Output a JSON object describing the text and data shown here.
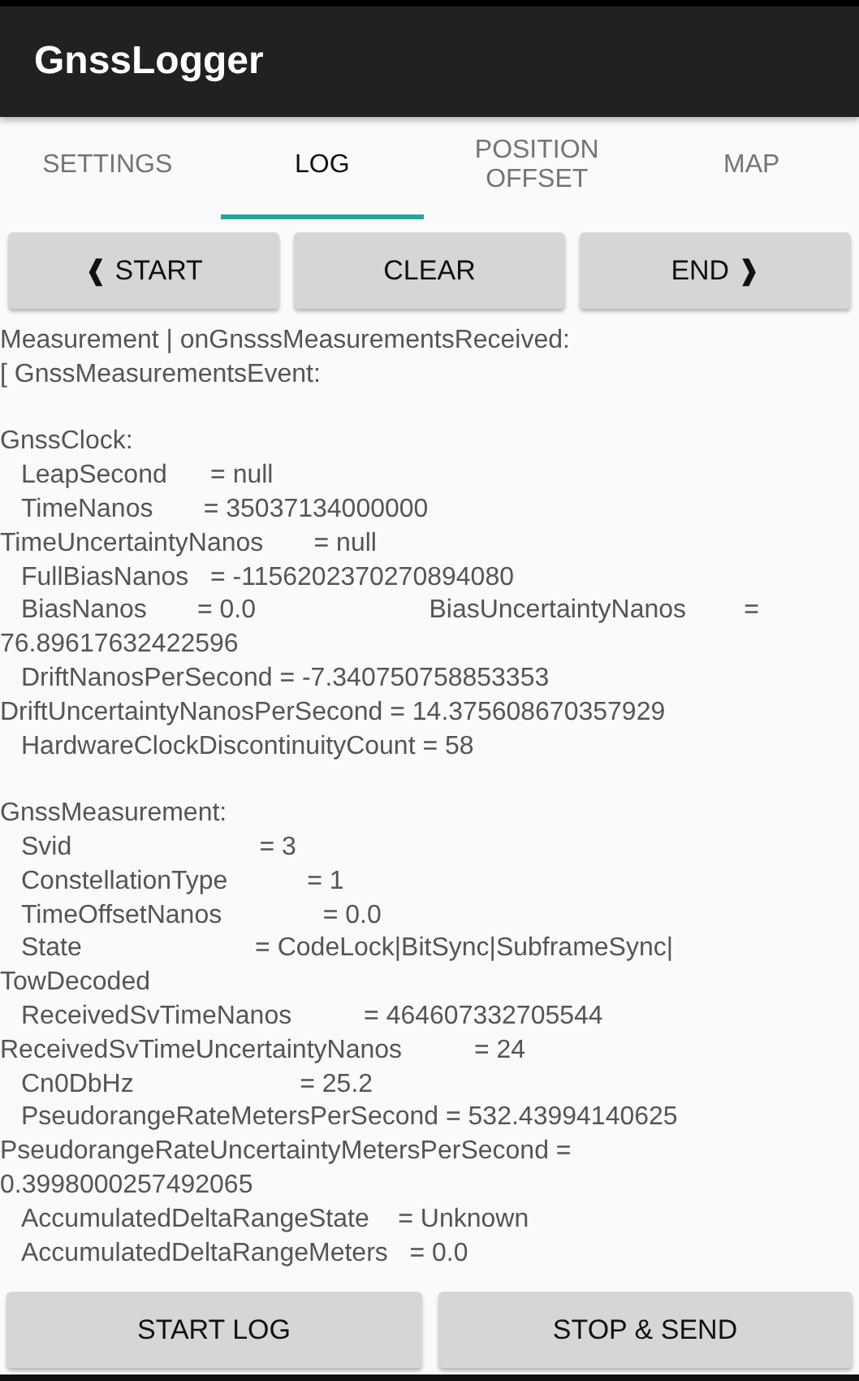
{
  "app_bar": {
    "title": "GnssLogger"
  },
  "tabs": [
    {
      "label": "SETTINGS",
      "selected": false
    },
    {
      "label": "LOG",
      "selected": true
    },
    {
      "label": "POSITION OFFSET",
      "selected": false
    },
    {
      "label": "MAP",
      "selected": false
    }
  ],
  "top_buttons": [
    "❰ START",
    "CLEAR",
    "END ❱"
  ],
  "log": [
    {
      "lines": [
        {
          "text": "Measurement | onGnsssMeasurementsReceived:",
          "indent": false
        },
        {
          "text": "[ GnssMeasurementsEvent:",
          "indent": false
        }
      ]
    },
    {
      "lines": [
        {
          "text": "GnssClock:",
          "indent": false
        },
        {
          "text": "LeapSecond      = null",
          "indent": true
        },
        {
          "text": "TimeNanos       = 35037134000000",
          "indent": true
        },
        {
          "text": "TimeUncertaintyNanos       = null",
          "indent": false
        },
        {
          "text": "FullBiasNanos   = -1156202370270894080",
          "indent": true
        },
        {
          "text": "BiasNanos       = 0.0                        BiasUncertaintyNanos        =",
          "indent": true
        },
        {
          "text": "76.89617632422596",
          "indent": false
        },
        {
          "text": "DriftNanosPerSecond = -7.340750758853353",
          "indent": true
        },
        {
          "text": "DriftUncertaintyNanosPerSecond = 14.375608670357929",
          "indent": false
        },
        {
          "text": "HardwareClockDiscontinuityCount = 58",
          "indent": true
        }
      ]
    },
    {
      "lines": [
        {
          "text": "GnssMeasurement:",
          "indent": false
        },
        {
          "text": "Svid                          = 3",
          "indent": true
        },
        {
          "text": "ConstellationType           = 1",
          "indent": true
        },
        {
          "text": "TimeOffsetNanos              = 0.0",
          "indent": true
        },
        {
          "text": "State                        = CodeLock|BitSync|SubframeSync|",
          "indent": true
        },
        {
          "text": "TowDecoded",
          "indent": false
        },
        {
          "text": "ReceivedSvTimeNanos          = 464607332705544",
          "indent": true
        },
        {
          "text": "ReceivedSvTimeUncertaintyNanos          = 24",
          "indent": false
        },
        {
          "text": "Cn0DbHz                       = 25.2",
          "indent": true
        },
        {
          "text": "PseudorangeRateMetersPerSecond = 532.43994140625",
          "indent": true
        },
        {
          "text": "PseudorangeRateUncertaintyMetersPerSecond =",
          "indent": false
        },
        {
          "text": "0.3998000257492065",
          "indent": false
        },
        {
          "text": "AccumulatedDeltaRangeState    = Unknown",
          "indent": true
        },
        {
          "text": "AccumulatedDeltaRangeMeters   = 0.0",
          "indent": true
        }
      ]
    }
  ],
  "bottom_buttons": [
    "START LOG",
    "STOP & SEND"
  ]
}
